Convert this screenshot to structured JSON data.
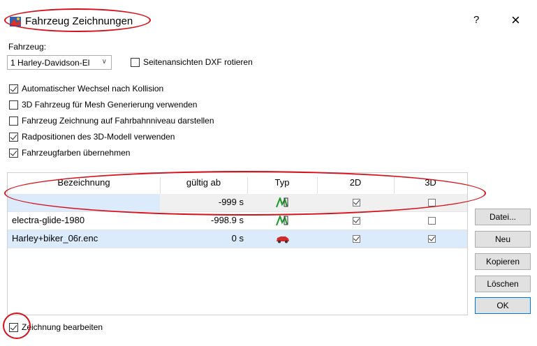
{
  "window": {
    "title": "Fahrzeug Zeichnungen",
    "help_label": "?",
    "close_label": "×"
  },
  "vehicle": {
    "label": "Fahrzeug:",
    "selected": "1  Harley-Davidson-El"
  },
  "options": {
    "rotate_dxf": "Seitenansichten DXF rotieren",
    "auto_switch": "Automatischer Wechsel nach Kollision",
    "mesh_3d": "3D Fahrzeug für Mesh Generierung verwenden",
    "road_level": "Fahrzeug Zeichnung auf Fahrbahnniveau darstellen",
    "wheel_pos": "Radpositionen des 3D-Modell verwenden",
    "colors": "Fahrzeugfarben übernehmen"
  },
  "grid": {
    "columns": [
      "Bezeichnung",
      "gültig ab",
      "Typ",
      "2D",
      "3D"
    ],
    "rows": [
      {
        "name": "",
        "valid_from": "-999 s",
        "type_icon": "vector-drawing-icon",
        "d2": true,
        "d3": false
      },
      {
        "name": "electra-glide-1980",
        "valid_from": "-998.9 s",
        "type_icon": "vector-drawing-icon",
        "d2": true,
        "d3": false
      },
      {
        "name": "Harley+biker_06r.enc",
        "valid_from": "0 s",
        "type_icon": "vehicle-image-icon",
        "d2": true,
        "d3": true
      }
    ]
  },
  "buttons": {
    "datei": "Datei...",
    "neu": "Neu",
    "kopieren": "Kopieren",
    "loeschen": "Löschen",
    "ok": "OK"
  },
  "footer": {
    "edit_drawing": "Zeichnung bearbeiten"
  },
  "annotation_color": "#d6101a"
}
